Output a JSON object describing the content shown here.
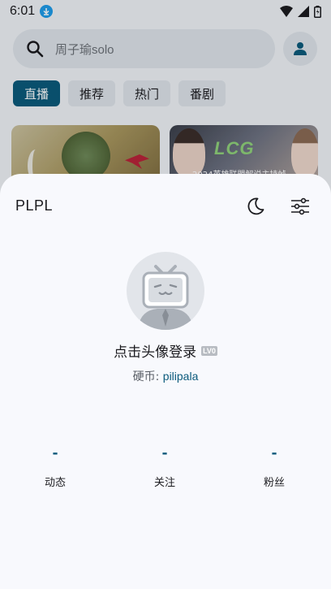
{
  "status_bar": {
    "time": "6:01",
    "icons": [
      "download-badge-icon",
      "wifi-icon",
      "signal-icon",
      "battery-icon"
    ]
  },
  "search": {
    "placeholder": "周子瑜solo",
    "icon": "search-icon"
  },
  "tabs": [
    {
      "label": "直播",
      "active": true
    },
    {
      "label": "推荐",
      "active": false
    },
    {
      "label": "热门",
      "active": false
    },
    {
      "label": "番剧",
      "active": false
    }
  ],
  "cards": [
    {
      "caption": ""
    },
    {
      "logo_text": "LCG",
      "caption": "2024英雄联盟解说主持帧"
    }
  ],
  "sheet": {
    "title": "PLPL",
    "icons": [
      "moon-icon",
      "tune-icon"
    ],
    "login_text": "点击头像登录",
    "level_badge": "LV0",
    "coin_label": "硬币: ",
    "coin_value": "pilipala",
    "stats": [
      {
        "value": "-",
        "label": "动态"
      },
      {
        "value": "-",
        "label": "关注"
      },
      {
        "value": "-",
        "label": "粉丝"
      }
    ]
  },
  "colors": {
    "accent": "#0b5a7c",
    "sheet_bg": "#f8f9fd",
    "download_badge": "#1e9be9"
  }
}
